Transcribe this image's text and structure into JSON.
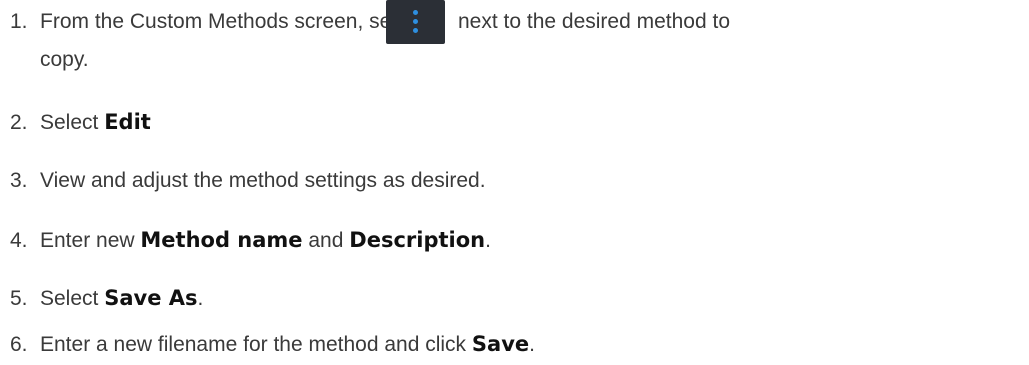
{
  "steps": [
    {
      "num": "1.",
      "before": "From the Custom Methods screen, select",
      "after": "next to the desired method to",
      "cont": "copy."
    },
    {
      "num": "2.",
      "text": "Select ",
      "bold": "Edit"
    },
    {
      "num": "3.",
      "text": "View and adjust the method settings as desired."
    },
    {
      "num": "4.",
      "text": "Enter new ",
      "bold1": "Method name",
      "mid": " and ",
      "bold2": "Description",
      "end": "."
    },
    {
      "num": "5.",
      "text": "Select ",
      "bold": "Save As",
      "end": "."
    },
    {
      "num": "6.",
      "text": "Enter a new filename for the method and click ",
      "bold": "Save",
      "end": "."
    }
  ],
  "icons": {
    "more_button": "more-vertical-icon",
    "colors": {
      "background": "#2b2f36",
      "dots": "#2e8fe0"
    }
  }
}
